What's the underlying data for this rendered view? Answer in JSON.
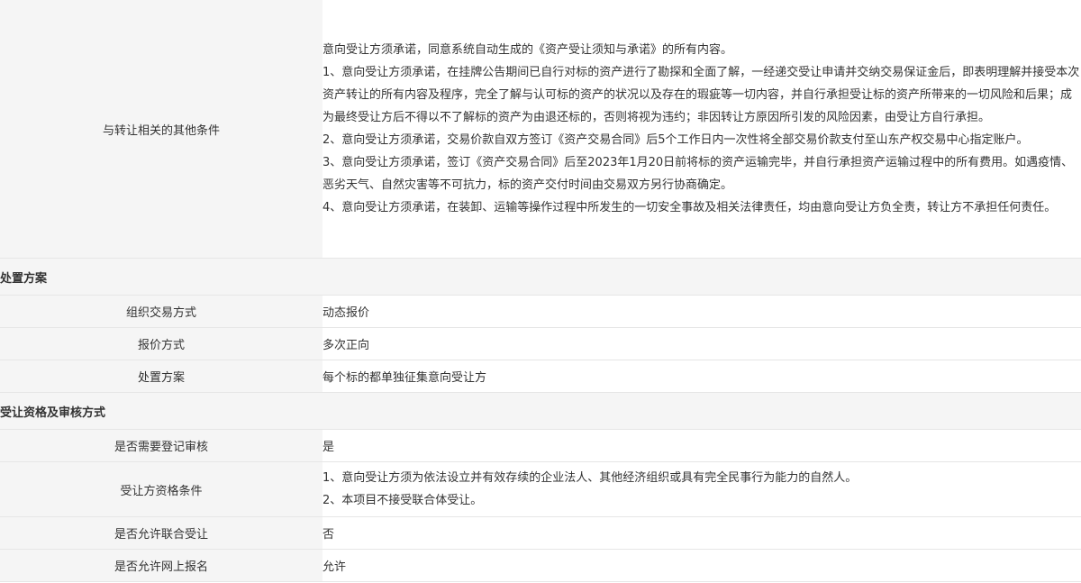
{
  "other_conditions": {
    "label": "与转让相关的其他条件",
    "paragraphs": [
      "意向受让方须承诺，同意系统自动生成的《资产受让须知与承诺》的所有内容。",
      "1、意向受让方须承诺，在挂牌公告期间已自行对标的资产进行了勘探和全面了解，一经递交受让申请并交纳交易保证金后，即表明理解并接受本次资产转让的所有内容及程序，完全了解与认可标的资产的状况以及存在的瑕疵等一切内容，并自行承担受让标的资产所带来的一切风险和后果；成为最终受让方后不得以不了解标的资产为由退还标的，否则将视为违约；非因转让方原因所引发的风险因素，由受让方自行承担。",
      "2、意向受让方须承诺，交易价款自双方签订《资产交易合同》后5个工作日内一次性将全部交易价款支付至山东产权交易中心指定账户。",
      "3、意向受让方须承诺，签订《资产交易合同》后至2023年1月20日前将标的资产运输完毕，并自行承担资产运输过程中的所有费用。如遇疫情、恶劣天气、自然灾害等不可抗力，标的资产交付时间由交易双方另行协商确定。",
      "4、意向受让方须承诺，在装卸、运输等操作过程中所发生的一切安全事故及相关法律责任，均由意向受让方负全责，转让方不承担任何责任。"
    ]
  },
  "disposal": {
    "section_title": "处置方案",
    "rows": [
      {
        "label": "组织交易方式",
        "value": "动态报价"
      },
      {
        "label": "报价方式",
        "value": "多次正向"
      },
      {
        "label": "处置方案",
        "value": "每个标的都单独征集意向受让方"
      }
    ]
  },
  "qualification": {
    "section_title": "受让资格及审核方式",
    "need_review": {
      "label": "是否需要登记审核",
      "value": "是"
    },
    "conditions": {
      "label": "受让方资格条件",
      "paragraphs": [
        "1、意向受让方须为依法设立并有效存续的企业法人、其他经济组织或具有完全民事行为能力的自然人。",
        "2、本项目不接受联合体受让。"
      ]
    },
    "joint": {
      "label": "是否允许联合受让",
      "value": "否"
    },
    "online": {
      "label": "是否允许网上报名",
      "value": "允许"
    }
  }
}
